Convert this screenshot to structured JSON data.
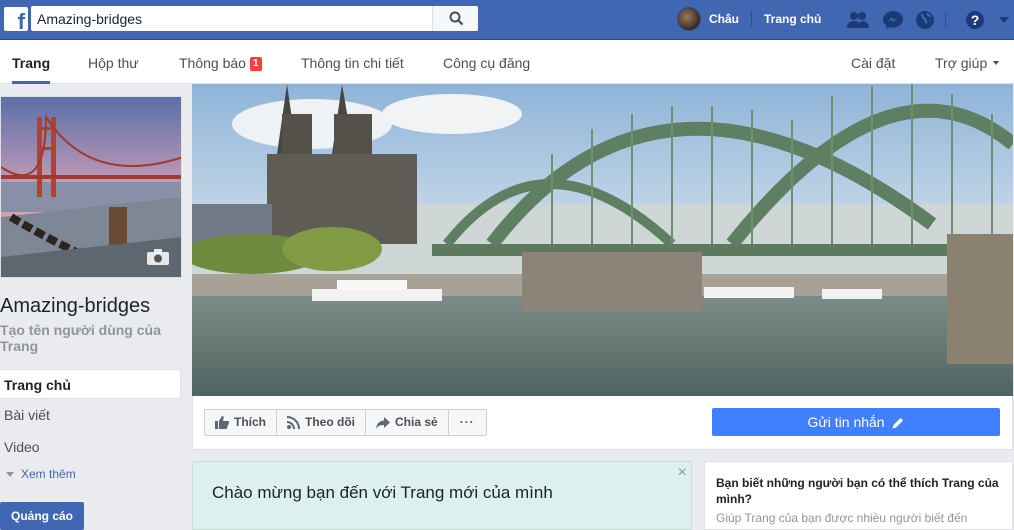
{
  "topbar": {
    "search_value": "Amazing-bridges",
    "user_name": "Châu",
    "home_label": "Trang chủ"
  },
  "subnav": {
    "tabs": [
      {
        "label": "Trang"
      },
      {
        "label": "Hộp thư"
      },
      {
        "label": "Thông báo",
        "badge": "1"
      },
      {
        "label": "Thông tin chi tiết"
      },
      {
        "label": "Công cụ đăng"
      }
    ],
    "settings_label": "Cài đặt",
    "help_label": "Trợ giúp"
  },
  "left": {
    "page_name": "Amazing-bridges",
    "create_username": "Tạo tên người dùng của Trang",
    "nav": [
      "Trang chủ",
      "Bài viết",
      "Video"
    ],
    "see_more": "Xem thêm",
    "ads_button": "Quảng cáo"
  },
  "actions": {
    "like": "Thích",
    "follow": "Theo dõi",
    "share": "Chia sẻ",
    "more": "···",
    "send_message": "Gửi tin nhắn"
  },
  "welcome": {
    "text": "Chào mừng bạn đến với Trang mới của mình",
    "close": "×"
  },
  "suggest": {
    "title": "Bạn biết những người bạn có thể thích Trang của mình?",
    "subtitle": "Giúp Trang của bạn được nhiều người biết đến"
  },
  "colors": {
    "brand_blue": "#4267b2",
    "send_button": "#4080ff",
    "badge_red": "#fa3e3e",
    "welcome_bg": "#dcf1ed"
  }
}
